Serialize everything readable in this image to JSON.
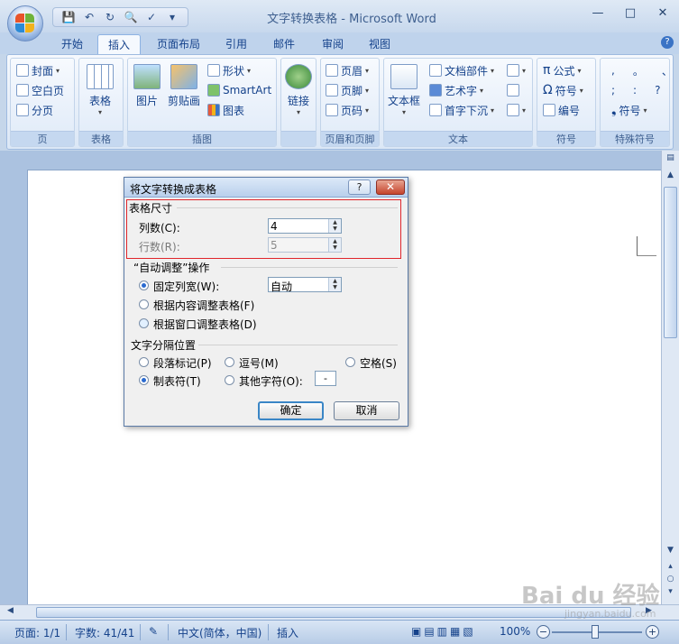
{
  "window": {
    "title": "文字转换表格 - Microsoft Word",
    "minimize": "—",
    "maximize": "□",
    "close": "✕"
  },
  "qat": {
    "save_icon": "save-icon",
    "undo_icon": "undo-icon",
    "redo_icon": "redo-icon",
    "print_preview_icon": "print-preview-icon",
    "spelling_icon": "spelling-icon",
    "customize_icon": "customize-icon"
  },
  "tabs": [
    "开始",
    "插入",
    "页面布局",
    "引用",
    "邮件",
    "审阅",
    "视图"
  ],
  "active_tab": "插入",
  "help": "?",
  "ribbon": {
    "page_group": {
      "label": "页",
      "cover": "封面",
      "blank": "空白页",
      "break": "分页"
    },
    "table_group": {
      "label": "表格",
      "table": "表格"
    },
    "illustrations_group": {
      "label": "插图",
      "picture": "图片",
      "clipart": "剪贴画",
      "shapes": "形状",
      "smartart": "SmartArt",
      "chart": "图表"
    },
    "links_group": {
      "label": "",
      "link": "链接"
    },
    "header_footer_group": {
      "label": "页眉和页脚",
      "header": "页眉",
      "footer": "页脚",
      "page_number": "页码"
    },
    "text_group": {
      "label": "文本",
      "textbox": "文本框",
      "quickparts": "文档部件",
      "wordart": "艺术字",
      "dropcap": "首字下沉"
    },
    "symbols_group": {
      "label": "符号",
      "equation": "公式",
      "symbol": "符号",
      "number": "编号"
    },
    "special_group": {
      "label": "特殊符号",
      "row1": [
        ",",
        "。",
        "、"
      ],
      "row2": [
        ";",
        ":",
        "?"
      ],
      "symbol": "符号"
    }
  },
  "dialog": {
    "title": "将文字转换成表格",
    "help": "?",
    "close": "✕",
    "size_section": "表格尺寸",
    "columns_label": "列数(C):",
    "columns_value": "4",
    "rows_label": "行数(R):",
    "rows_value": "5",
    "autofit_section": "“自动调整”操作",
    "fixed_width": "固定列宽(W):",
    "fixed_width_value": "自动",
    "autofit_content": "根据内容调整表格(F)",
    "autofit_window": "根据窗口调整表格(D)",
    "separator_section": "文字分隔位置",
    "paragraph": "段落标记(P)",
    "comma": "逗号(M)",
    "space": "空格(S)",
    "tab": "制表符(T)",
    "other": "其他字符(O):",
    "other_value": "-",
    "ok": "确定",
    "cancel": "取消"
  },
  "status": {
    "page": "页面: 1/1",
    "words": "字数: 41/41",
    "language": "中文(简体，中国)",
    "mode": "插入",
    "zoom": "100%",
    "zoom_out": "−",
    "zoom_in": "+"
  },
  "watermark": {
    "main": "Bai du 经验",
    "sub": "jingyan.baidu.com"
  }
}
